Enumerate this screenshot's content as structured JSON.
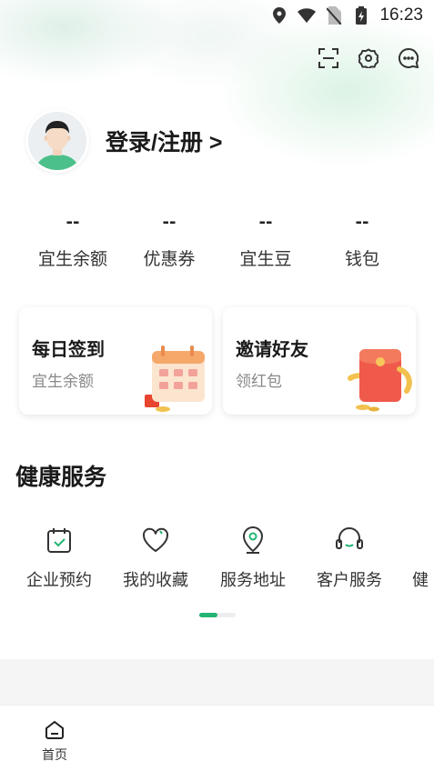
{
  "status_bar": {
    "time": "16:23",
    "icons": [
      "location-icon",
      "wifi-icon",
      "no-sim-icon",
      "battery-charging-icon"
    ]
  },
  "header": {
    "actions": [
      "scan-icon",
      "settings-icon",
      "message-icon"
    ]
  },
  "profile": {
    "login_label": "登录/注册 >"
  },
  "stats": [
    {
      "value": "--",
      "label": "宜生余额"
    },
    {
      "value": "--",
      "label": "优惠券"
    },
    {
      "value": "--",
      "label": "宜生豆"
    },
    {
      "value": "--",
      "label": "钱包"
    }
  ],
  "cards": [
    {
      "title": "每日签到",
      "subtitle": "宜生余额"
    },
    {
      "title": "邀请好友",
      "subtitle": "领红包"
    }
  ],
  "health_section": {
    "title": "健康服务",
    "items": [
      {
        "label": "企业预约",
        "icon": "calendar-check-icon"
      },
      {
        "label": "我的收藏",
        "icon": "heart-icon"
      },
      {
        "label": "服务地址",
        "icon": "map-pin-icon"
      },
      {
        "label": "客户服务",
        "icon": "headset-icon"
      },
      {
        "label": "健",
        "icon": ""
      }
    ]
  },
  "pager": {
    "current": 1,
    "total": 2
  },
  "colors": {
    "accent": "#22b573",
    "text": "#1a1a1a",
    "muted": "#888888"
  },
  "tabbar": {
    "items": [
      {
        "label": "首页",
        "icon": "home-icon"
      }
    ]
  }
}
